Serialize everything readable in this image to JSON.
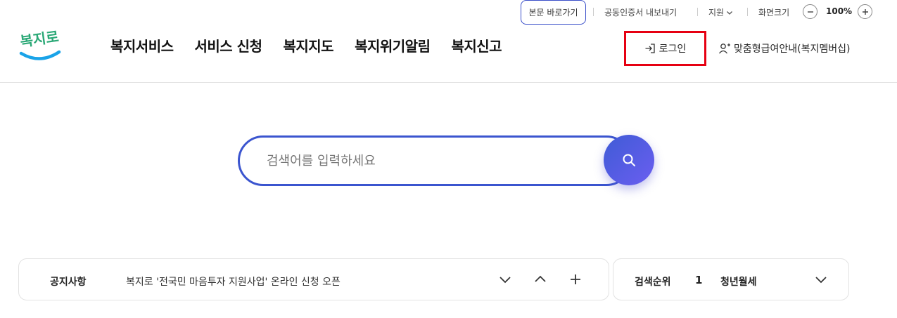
{
  "util": {
    "skip_link": "본문 바로가기",
    "cert_export": "공동인증서 내보내기",
    "support": "지원",
    "zoom_label": "화면크기",
    "zoom_value": "100%"
  },
  "logo": {
    "text": "복지로"
  },
  "gnb": {
    "items": [
      "복지서비스",
      "서비스 신청",
      "복지지도",
      "복지위기알림",
      "복지신고"
    ]
  },
  "header": {
    "login": "로그인",
    "membership": "맞춤형급여안내(복지멤버십)"
  },
  "search": {
    "placeholder": "검색어를 입력하세요"
  },
  "notice": {
    "title": "공지사항",
    "text": "복지로 '전국민 마음투자 지원사업' 온라인 신청 오픈"
  },
  "rank": {
    "title": "검색순위",
    "number": "1",
    "keyword": "청년월세"
  },
  "colors": {
    "accent": "#3b55cf",
    "highlight": "#e60012",
    "logo_blue": "#1aa3e8",
    "logo_green": "#2aa876"
  }
}
